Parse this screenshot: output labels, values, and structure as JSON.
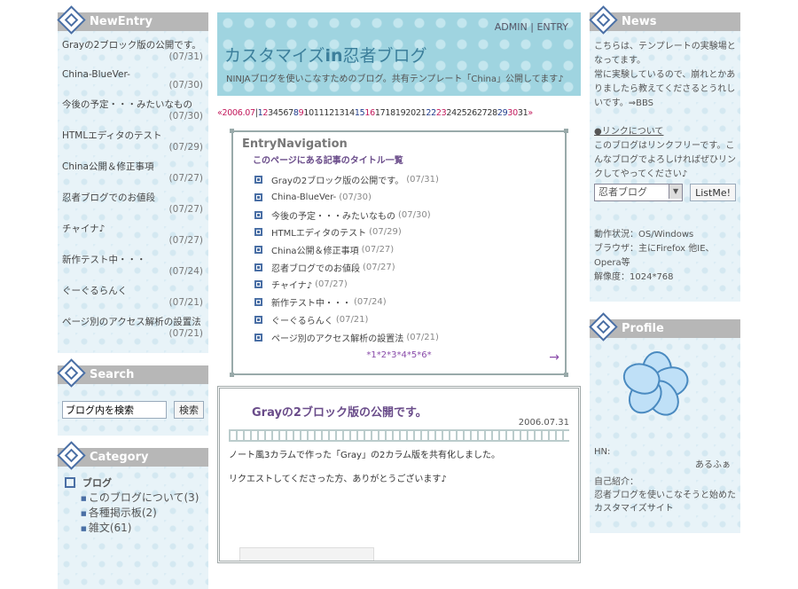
{
  "header": {
    "admin": "ADMIN",
    "separator": "|",
    "entry": "ENTRY",
    "title_pre": "カスタマイズ",
    "title_in": "in",
    "title_post": "忍者ブログ",
    "description": "NINJAブログを使いこなすためのブログ。共有テンプレート「China」公開してます♪"
  },
  "calendar": {
    "prev": "«2006.07",
    "separator": "|",
    "days": [
      "1",
      "2",
      "3",
      "4",
      "5",
      "6",
      "7",
      "8",
      "9",
      "10",
      "11",
      "12",
      "13",
      "14",
      "15",
      "16",
      "17",
      "18",
      "19",
      "20",
      "21",
      "22",
      "23",
      "24",
      "25",
      "26",
      "27",
      "28",
      "29",
      "30",
      "31"
    ],
    "next": "»"
  },
  "new_entry": {
    "title": "NewEntry",
    "items": [
      {
        "title": "Grayの2ブロック版の公開です。",
        "date": "(07/31)"
      },
      {
        "title": "China-BlueVer-",
        "date": "(07/30)"
      },
      {
        "title": "今後の予定・・・みたいなもの",
        "date": "(07/30)"
      },
      {
        "title": "HTMLエディタのテスト",
        "date": "(07/29)"
      },
      {
        "title": "China公開＆修正事項",
        "date": "(07/27)"
      },
      {
        "title": "忍者ブログでのお値段",
        "date": "(07/27)"
      },
      {
        "title": "チャイナ♪",
        "date": "(07/27)"
      },
      {
        "title": "新作テスト中・・・",
        "date": "(07/24)"
      },
      {
        "title": "ぐーぐるらんく",
        "date": "(07/21)"
      },
      {
        "title": "ページ別のアクセス解析の設置法",
        "date": "(07/21)"
      }
    ]
  },
  "search": {
    "title": "Search",
    "value": "ブログ内を検索",
    "button": "検索"
  },
  "category": {
    "title": "Category",
    "root": "ブログ",
    "items": [
      "このブログについて(3)",
      "各種掲示板(2)",
      "雑文(61)"
    ]
  },
  "navigation": {
    "title": "EntryNavigation",
    "subtitle": "このページにある記事のタイトル一覧",
    "items": [
      {
        "title": "Grayの2ブロック版の公開です。",
        "date": "(07/31)"
      },
      {
        "title": "China-BlueVer-",
        "date": "(07/30)"
      },
      {
        "title": "今後の予定・・・みたいなもの",
        "date": "(07/30)"
      },
      {
        "title": "HTMLエディタのテスト",
        "date": "(07/29)"
      },
      {
        "title": "China公開＆修正事項",
        "date": "(07/27)"
      },
      {
        "title": "忍者ブログでのお値段",
        "date": "(07/27)"
      },
      {
        "title": "チャイナ♪",
        "date": "(07/27)"
      },
      {
        "title": "新作テスト中・・・",
        "date": "(07/24)"
      },
      {
        "title": "ぐーぐるらんく",
        "date": "(07/21)"
      },
      {
        "title": "ページ別のアクセス解析の設置法",
        "date": "(07/21)"
      }
    ],
    "pager": "*1*2*3*4*5*6*",
    "next": "→"
  },
  "article": {
    "title": "Grayの2ブロック版の公開です。",
    "date": "2006.07.31",
    "paragraph1": "ノート風3カラムで作った「Gray」の2カラム版を共有化しました。",
    "paragraph2": "リクエストしてくださった方、ありがとうございます♪"
  },
  "news": {
    "title": "News",
    "text1": "こちらは、テンプレートの実験場となってます。",
    "text2": "常に実験しているので、崩れとかありましたら教えてくださるとうれしいです。⇒",
    "bbs": "BBS",
    "link_label": "●リンクについて",
    "link_text": "このブログはリンクフリーです。こんなブログでよろしければぜひリンクしてやってください♪",
    "select_value": "忍者ブログ",
    "listme": "ListMe!",
    "status1": "動作状況：OS/Windows",
    "status2": "ブラウザ：主にFirefox  他IE、Opera等",
    "status3": "解像度：1024*768"
  },
  "profile": {
    "title": "Profile",
    "hn_label": "HN:",
    "hn_value": "あるふぁ",
    "intro_label": "自己紹介：",
    "intro_text": "忍者ブログを使いこなそうと始めたカスタマイズサイト"
  }
}
